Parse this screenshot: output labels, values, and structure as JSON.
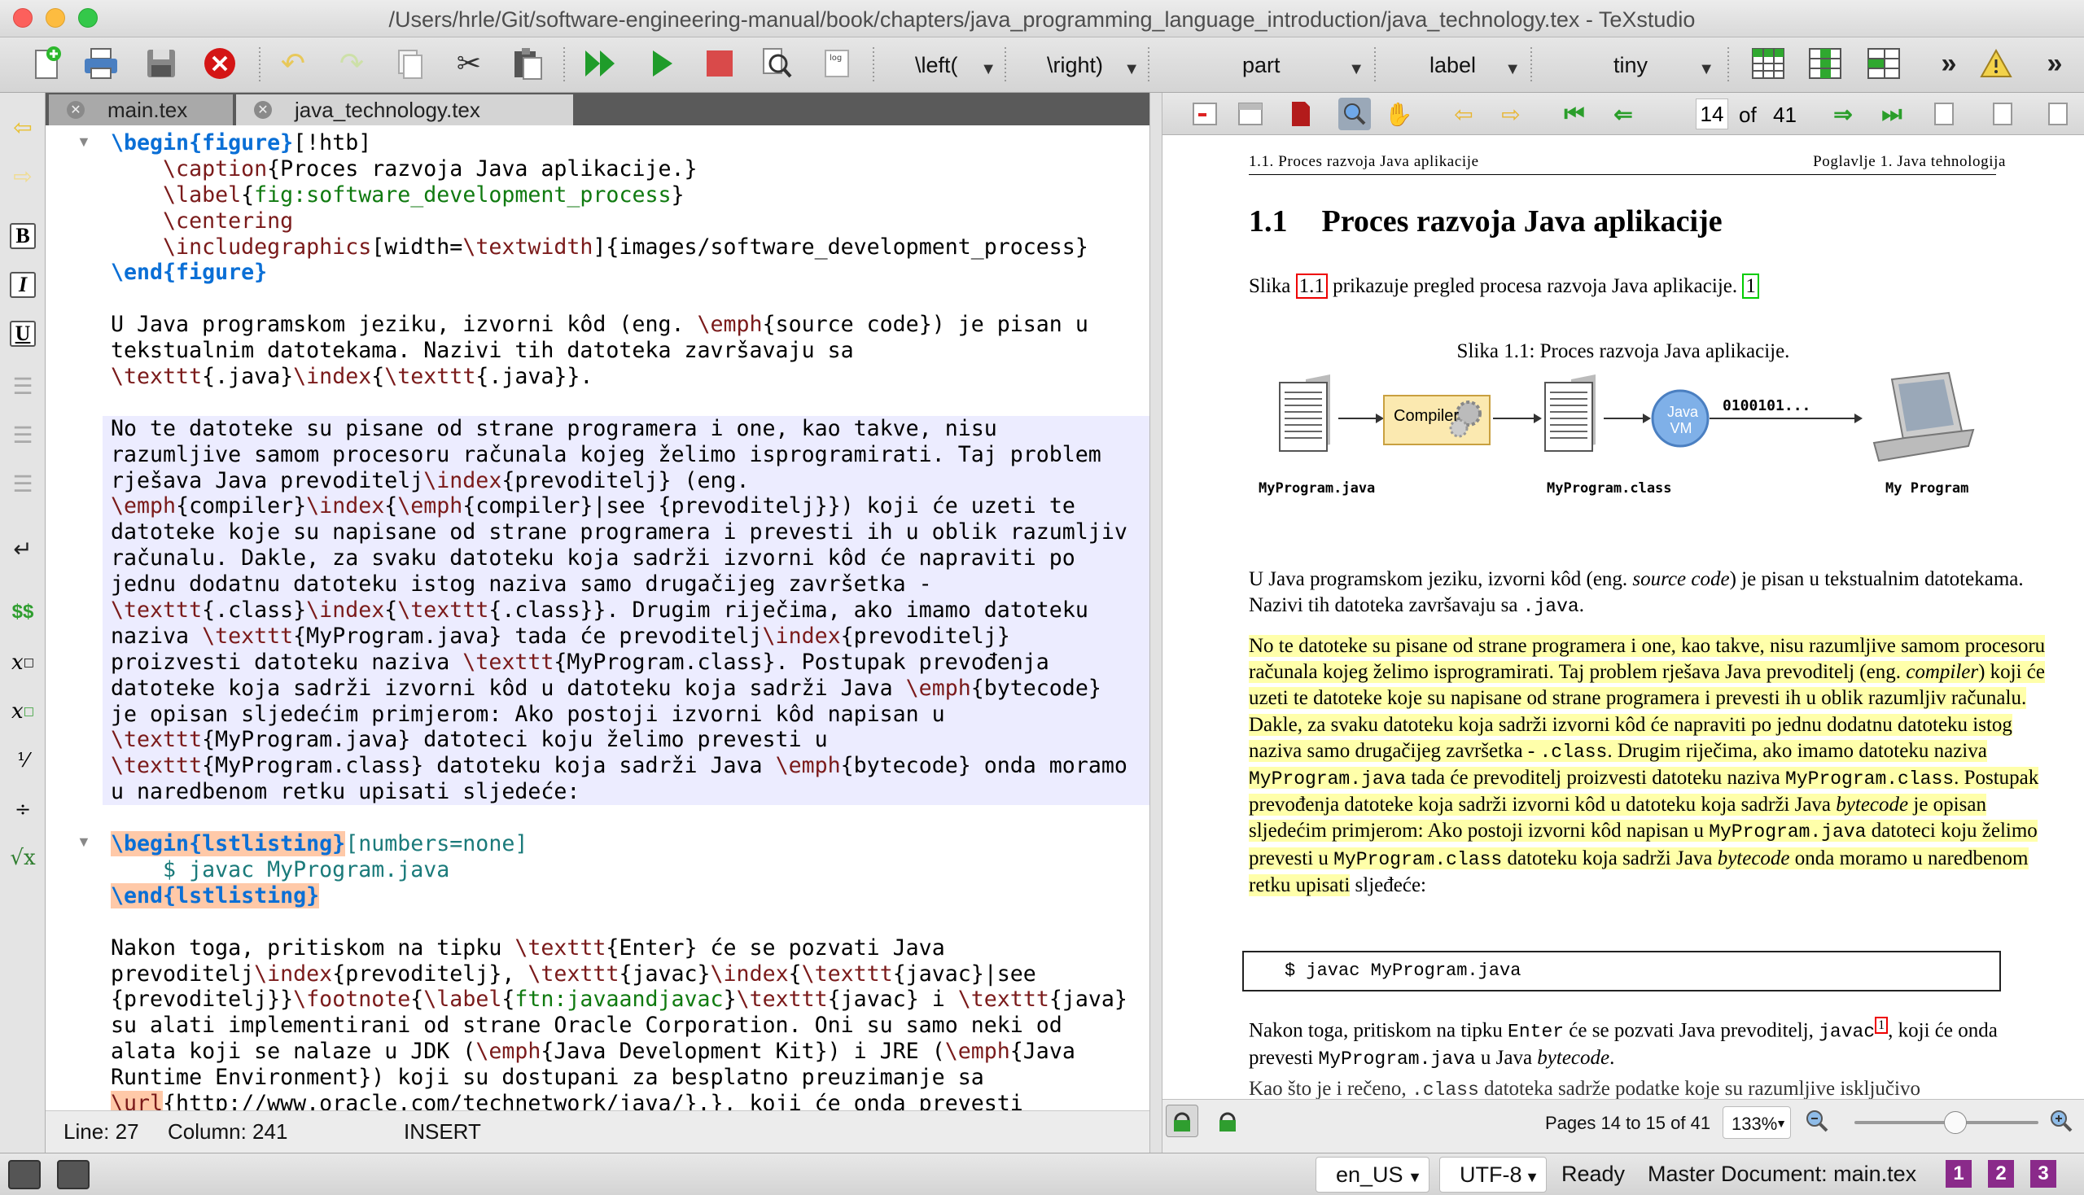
{
  "window": {
    "title": "/Users/hrle/Git/software-engineering-manual/book/chapters/java_programming_language_introduction/java_technology.tex - TeXstudio"
  },
  "toolbar": {
    "left_cmd": "\\left(",
    "right_cmd": "\\right)",
    "structure_combo": "part",
    "label_combo": "label",
    "size_combo": "tiny",
    "more": "»"
  },
  "tabs": [
    {
      "label": "main.tex"
    },
    {
      "label": "java_technology.tex"
    }
  ],
  "editor_status": {
    "line": "Line: 27",
    "column": "Column: 241",
    "mode": "INSERT"
  },
  "pdf_toolbar": {
    "page": "14",
    "of_label": "of",
    "total_pages": "41"
  },
  "pdf": {
    "header_left": "1.1.  Proces razvoja Java aplikacije",
    "header_right": "Poglavlje 1.  Java tehnologija",
    "section_number": "1.1",
    "section_title": "Proces razvoja Java aplikacije",
    "intro_pre": "Slika ",
    "intro_ref": "1.1",
    "intro_post": " prikazuje pregled procesa razvoja Java aplikacije. ",
    "intro_footref": "1",
    "caption": "Slika 1.1: Proces razvoja Java aplikacije.",
    "figure": {
      "file1": "MyProgram.java",
      "compiler": "Compiler",
      "file2": "MyProgram.class",
      "jvm_line1": "Java",
      "jvm_line2": "VM",
      "bytecode": "0100101...",
      "program": "My Program"
    },
    "code_line": "$ javac MyProgram.java"
  },
  "pdf_status": {
    "pages": "Pages 14 to 15 of 41",
    "zoom": "133%"
  },
  "statusbar": {
    "language": "en_US",
    "encoding": "UTF-8",
    "state": "Ready",
    "master": "Master Document: main.tex"
  }
}
